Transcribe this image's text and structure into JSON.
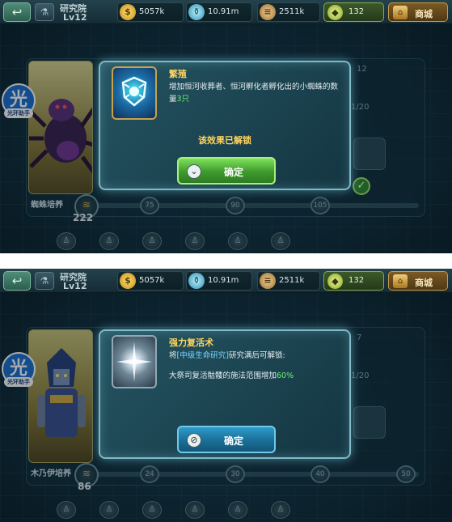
{
  "colors": {
    "gold_text": "#ffd55e",
    "highlight_green": "#6ff06b",
    "link_blue": "#79d7ff",
    "confirm_green": "#3e9a2c",
    "confirm_blue": "#1a6f98"
  },
  "screens": [
    {
      "header": {
        "title": "研究院",
        "level": "Lv12",
        "resources": [
          {
            "icon": "gold-coins-icon",
            "value": "5057k"
          },
          {
            "icon": "potion-flask-icon",
            "value": "10.91m"
          },
          {
            "icon": "wood-logs-icon",
            "value": "2511k"
          }
        ],
        "gems": "132",
        "shop_label": "商城"
      },
      "helper": {
        "badge": "光",
        "label": "光环助手"
      },
      "tree": {
        "card_name": "蜘蛛培养",
        "level": "222",
        "nodes": [
          "75",
          "90",
          "105"
        ],
        "bg_numbers": [
          "11",
          "12"
        ],
        "bg_counter": "1/20"
      },
      "dialog": {
        "icon": "spider-crest-icon",
        "title": "繁殖",
        "desc_main": "增加恒河收葬者、恒河孵化者孵化出的小蜘蛛的数量",
        "desc_highlight": "3只",
        "unlocked_msg": "该效果已解锁",
        "button_label": "确定"
      }
    },
    {
      "header": {
        "title": "研究院",
        "level": "Lv12",
        "resources": [
          {
            "icon": "gold-coins-icon",
            "value": "5057k"
          },
          {
            "icon": "potion-flask-icon",
            "value": "10.91m"
          },
          {
            "icon": "wood-logs-icon",
            "value": "2511k"
          }
        ],
        "gems": "132",
        "shop_label": "商城"
      },
      "helper": {
        "badge": "光",
        "label": "光环助手"
      },
      "tree": {
        "card_name": "木乃伊培养",
        "level": "86",
        "nodes": [
          "24",
          "30",
          "40",
          "50"
        ],
        "bg_numbers": [
          "7"
        ],
        "bg_counter": "1/20"
      },
      "dialog": {
        "icon": "revive-light-icon",
        "title": "强力复活术",
        "req_prefix": "将",
        "req_link": "[中级生命研究]",
        "req_suffix": "研究满后可解锁:",
        "effect_main": "大祭司复活骷髅的施法范围增加",
        "effect_highlight": "60%",
        "button_label": "确定"
      }
    }
  ]
}
